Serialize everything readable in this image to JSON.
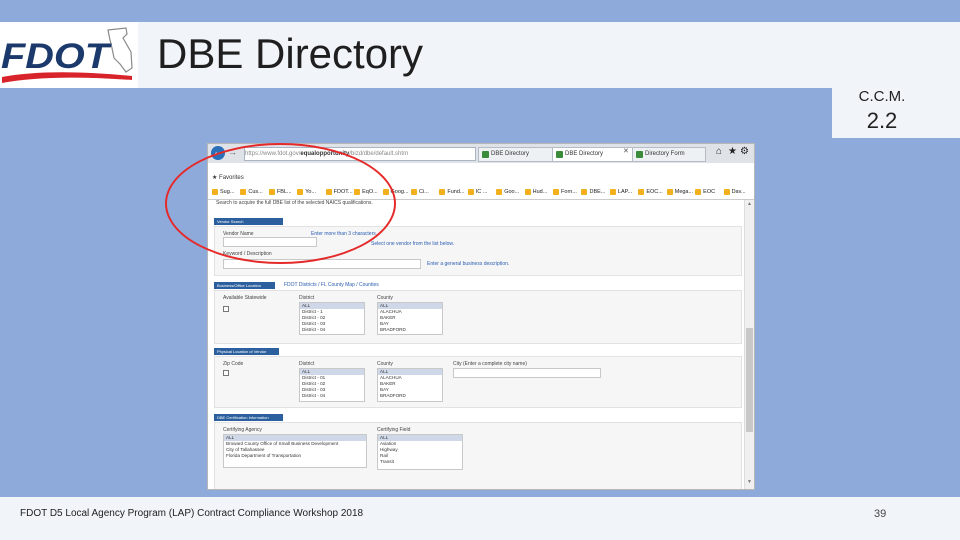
{
  "slide": {
    "title": "DBE Directory",
    "ccm_label": "C.C.M.",
    "ccm_number": "2.2",
    "footer_text": "FDOT D5 Local Agency Program (LAP) Contract Compliance Workshop 2018",
    "page_number": "39",
    "logo_text": "FDOT",
    "annotation_color": "#e52a2a"
  },
  "browser": {
    "back_icon": "back-arrow-icon",
    "address_prefix": "https://www.fdot.gov/",
    "address_bold": "equalopportunity",
    "address_rest": "/bizd/dbe/default.shtm",
    "tabs": [
      {
        "label": "DBE Directory"
      },
      {
        "label": "DBE Directory"
      },
      {
        "label": "Directory Form"
      }
    ],
    "window_icons": [
      "home-icon",
      "star-icon",
      "gear-icon"
    ],
    "favorites_label": "Favorites",
    "bookmarks": [
      "Sug...",
      "Cus...",
      "FBL...",
      "Yo...",
      "FDOT...",
      "EqO...",
      "Goog...",
      "Ci...",
      "Fund...",
      "IC ...",
      "Goo...",
      "Hud...",
      "Forn...",
      "DBE...",
      "LAP...",
      "EOC...",
      "Mega...",
      "EOC",
      "Dav..."
    ]
  },
  "form": {
    "intro": "Search to acquire the full DBE list of the selected NAICS qualifications.",
    "vendor_section": "Vendor Search",
    "vendor_name_label": "Vendor Name",
    "vendor_name_hint": "Enter more than 3 characters.",
    "vendor_select_hint": "Select one vendor from the list below.",
    "keyword_label": "Keyword / Description",
    "keyword_hint": "Enter a general business description.",
    "location_section": "Business/Office Location",
    "location_link": "FDOT Districts / FL County Map / Counties",
    "available_label": "Available Statewide",
    "district_label": "District",
    "county_label": "County",
    "district_items": [
      "ALL",
      "District - 1",
      "District - 02",
      "District - 03",
      "District - 04"
    ],
    "county_items": [
      "ALL",
      "ALACHUA",
      "BAKER",
      "BAY",
      "BRADFORD"
    ],
    "physical_section": "Physical Location of Vendor",
    "zip_label": "Zip Code",
    "city_label": "City",
    "city_hint": "City (Enter a complete city name)",
    "district_items2": [
      "ALL",
      "District - 01",
      "District - 02",
      "District - 03",
      "District - 04"
    ],
    "county_items2": [
      "ALL",
      "ALACHUA",
      "BAKER",
      "BAY",
      "BRADFORD"
    ],
    "cert_section": "DBE Certification Information",
    "cert_agency_label": "Certifying Agency",
    "cert_agency_items": [
      "ALL",
      "Broward County Office of Small Business Development",
      "City of Tallahassee",
      "Florida Department of Transportation"
    ],
    "cert_field_label": "Certifying Field",
    "cert_field_items": [
      "ALL",
      "Aviation",
      "Highway",
      "Rail",
      "Transit"
    ]
  }
}
